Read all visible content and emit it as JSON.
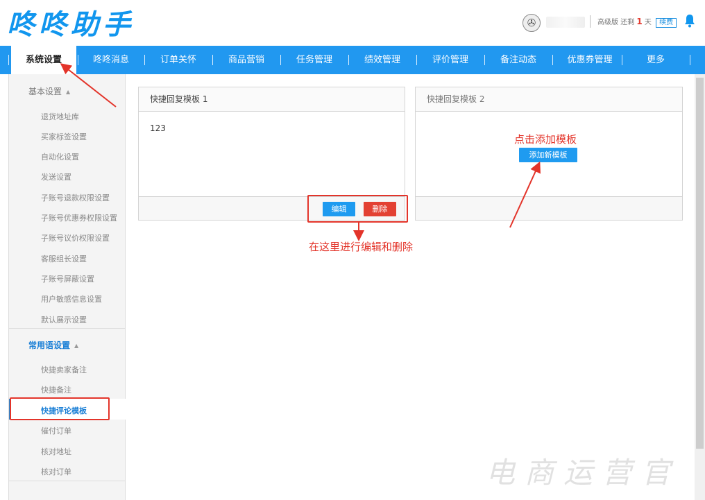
{
  "header": {
    "logo_text": "咚咚助手",
    "edition_label": "高级版",
    "remaining_prefix": "还剩",
    "remaining_days": "1",
    "remaining_suffix": "天",
    "renew_label": "续费"
  },
  "nav": {
    "items": [
      {
        "label": "系统设置"
      },
      {
        "label": "咚咚消息"
      },
      {
        "label": "订单关怀"
      },
      {
        "label": "商品营销"
      },
      {
        "label": "任务管理"
      },
      {
        "label": "绩效管理"
      },
      {
        "label": "评价管理"
      },
      {
        "label": "备注动态"
      },
      {
        "label": "优惠券管理"
      },
      {
        "label": "更多"
      }
    ]
  },
  "sidebar": {
    "group1": {
      "label": "基本设置",
      "items": [
        {
          "label": "退货地址库"
        },
        {
          "label": "买家标签设置"
        },
        {
          "label": "自动化设置"
        },
        {
          "label": "发送设置"
        },
        {
          "label": "子账号退款权限设置"
        },
        {
          "label": "子账号优惠券权限设置"
        },
        {
          "label": "子账号议价权限设置"
        },
        {
          "label": "客服组长设置"
        },
        {
          "label": "子账号屏蔽设置"
        },
        {
          "label": "用户敏感信息设置"
        },
        {
          "label": "默认展示设置"
        }
      ]
    },
    "group2": {
      "label": "常用语设置",
      "items": [
        {
          "label": "快捷卖家备注"
        },
        {
          "label": "快捷备注"
        },
        {
          "label": "快捷评论模板"
        },
        {
          "label": "催付订单"
        },
        {
          "label": "核对地址"
        },
        {
          "label": "核对订单"
        }
      ]
    }
  },
  "panels": {
    "template1": {
      "title": "快捷回复模板 1",
      "content": "123",
      "edit_label": "编辑",
      "delete_label": "删除"
    },
    "template2": {
      "title": "快捷回复模板 2",
      "add_label": "添加新模板"
    }
  },
  "annotations": {
    "edit_delete_note": "在这里进行编辑和删除",
    "add_note": "点击添加模板"
  },
  "watermark": "电商运营官",
  "colors": {
    "brand_blue": "#2198f0",
    "annotation_red": "#e3342a",
    "delete_red": "#e34133"
  },
  "icons": {
    "avatar": "avatar-icon",
    "bell": "bell-icon"
  }
}
